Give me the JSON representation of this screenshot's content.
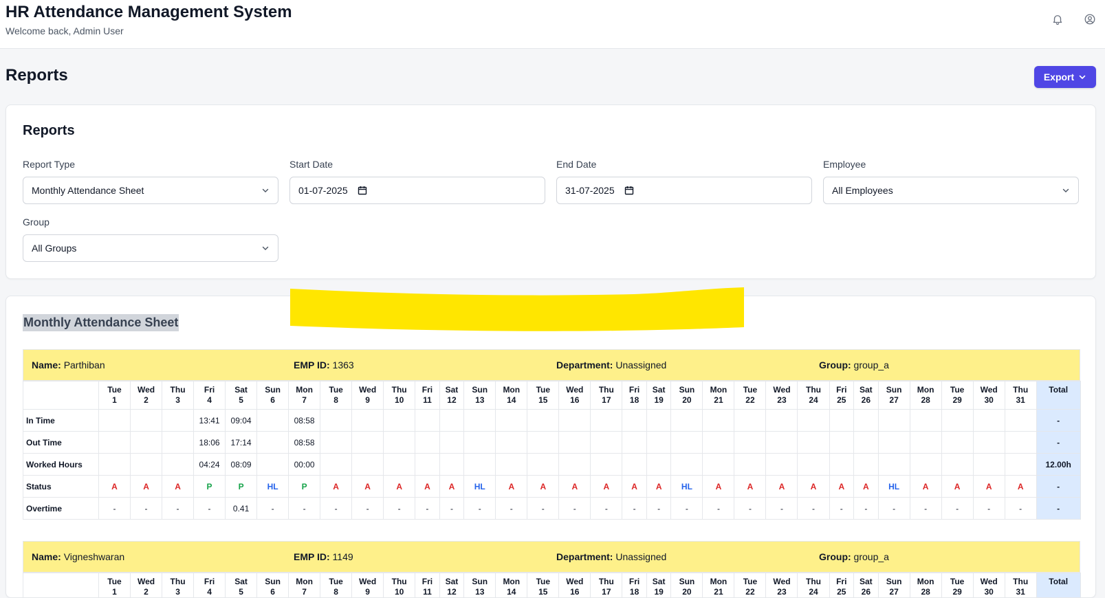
{
  "app": {
    "title": "HR Attendance Management System",
    "welcome": "Welcome back, Admin User",
    "icons": [
      "bell-icon",
      "user-circle-icon"
    ]
  },
  "page": {
    "title": "Reports",
    "export_label": "Export"
  },
  "filters": {
    "title": "Reports",
    "report_type": {
      "label": "Report Type",
      "value": "Monthly Attendance Sheet"
    },
    "start_date": {
      "label": "Start Date",
      "value": "01-07-2025"
    },
    "end_date": {
      "label": "End Date",
      "value": "31-07-2025"
    },
    "employee": {
      "label": "Employee",
      "value": "All Employees"
    },
    "group": {
      "label": "Group",
      "value": "All Groups"
    }
  },
  "sheet": {
    "title": "Monthly Attendance Sheet",
    "labels": {
      "name": "Name:",
      "emp_id": "EMP ID:",
      "department": "Department:",
      "group": "Group:"
    },
    "row_labels": [
      "In Time",
      "Out Time",
      "Worked Hours",
      "Status",
      "Overtime"
    ],
    "total_label": "Total",
    "days": [
      {
        "dow": "Tue",
        "d": "1"
      },
      {
        "dow": "Wed",
        "d": "2"
      },
      {
        "dow": "Thu",
        "d": "3"
      },
      {
        "dow": "Fri",
        "d": "4"
      },
      {
        "dow": "Sat",
        "d": "5"
      },
      {
        "dow": "Sun",
        "d": "6"
      },
      {
        "dow": "Mon",
        "d": "7"
      },
      {
        "dow": "Tue",
        "d": "8"
      },
      {
        "dow": "Wed",
        "d": "9"
      },
      {
        "dow": "Thu",
        "d": "10"
      },
      {
        "dow": "Fri",
        "d": "11"
      },
      {
        "dow": "Sat",
        "d": "12"
      },
      {
        "dow": "Sun",
        "d": "13"
      },
      {
        "dow": "Mon",
        "d": "14"
      },
      {
        "dow": "Tue",
        "d": "15"
      },
      {
        "dow": "Wed",
        "d": "16"
      },
      {
        "dow": "Thu",
        "d": "17"
      },
      {
        "dow": "Fri",
        "d": "18"
      },
      {
        "dow": "Sat",
        "d": "19"
      },
      {
        "dow": "Sun",
        "d": "20"
      },
      {
        "dow": "Mon",
        "d": "21"
      },
      {
        "dow": "Tue",
        "d": "22"
      },
      {
        "dow": "Wed",
        "d": "23"
      },
      {
        "dow": "Thu",
        "d": "24"
      },
      {
        "dow": "Fri",
        "d": "25"
      },
      {
        "dow": "Sat",
        "d": "26"
      },
      {
        "dow": "Sun",
        "d": "27"
      },
      {
        "dow": "Mon",
        "d": "28"
      },
      {
        "dow": "Tue",
        "d": "29"
      },
      {
        "dow": "Wed",
        "d": "30"
      },
      {
        "dow": "Thu",
        "d": "31"
      }
    ],
    "employees": [
      {
        "name": "Parthiban",
        "emp_id": "1363",
        "department": "Unassigned",
        "group": "group_a",
        "in_time": [
          "",
          "",
          "",
          "13:41",
          "09:04",
          "",
          "08:58",
          "",
          "",
          "",
          "",
          "",
          "",
          "",
          "",
          "",
          "",
          "",
          "",
          "",
          "",
          "",
          "",
          "",
          "",
          "",
          "",
          "",
          "",
          "",
          ""
        ],
        "out_time": [
          "",
          "",
          "",
          "18:06",
          "17:14",
          "",
          "08:58",
          "",
          "",
          "",
          "",
          "",
          "",
          "",
          "",
          "",
          "",
          "",
          "",
          "",
          "",
          "",
          "",
          "",
          "",
          "",
          "",
          "",
          "",
          "",
          ""
        ],
        "worked_hours": [
          "",
          "",
          "",
          "04:24",
          "08:09",
          "",
          "00:00",
          "",
          "",
          "",
          "",
          "",
          "",
          "",
          "",
          "",
          "",
          "",
          "",
          "",
          "",
          "",
          "",
          "",
          "",
          "",
          "",
          "",
          "",
          "",
          ""
        ],
        "status": [
          "A",
          "A",
          "A",
          "P",
          "P",
          "HL",
          "P",
          "A",
          "A",
          "A",
          "A",
          "A",
          "HL",
          "A",
          "A",
          "A",
          "A",
          "A",
          "A",
          "HL",
          "A",
          "A",
          "A",
          "A",
          "A",
          "A",
          "HL",
          "A",
          "A",
          "A",
          "A"
        ],
        "overtime": [
          "-",
          "-",
          "-",
          "-",
          "0.41",
          "-",
          "-",
          "-",
          "-",
          "-",
          "-",
          "-",
          "-",
          "-",
          "-",
          "-",
          "-",
          "-",
          "-",
          "-",
          "-",
          "-",
          "-",
          "-",
          "-",
          "-",
          "-",
          "-",
          "-",
          "-",
          "-"
        ],
        "totals": [
          "-",
          "-",
          "12.00h",
          "-",
          "-"
        ]
      },
      {
        "name": "Vigneshwaran",
        "emp_id": "1149",
        "department": "Unassigned",
        "group": "group_a"
      }
    ]
  },
  "colors": {
    "accent": "#4f46e5",
    "header_yellow": "#fef08a",
    "total_blue": "#dbeafe",
    "absent": "#dc2626",
    "present": "#16a34a",
    "holiday": "#2563eb",
    "highlight_marker": "#ffe600"
  }
}
